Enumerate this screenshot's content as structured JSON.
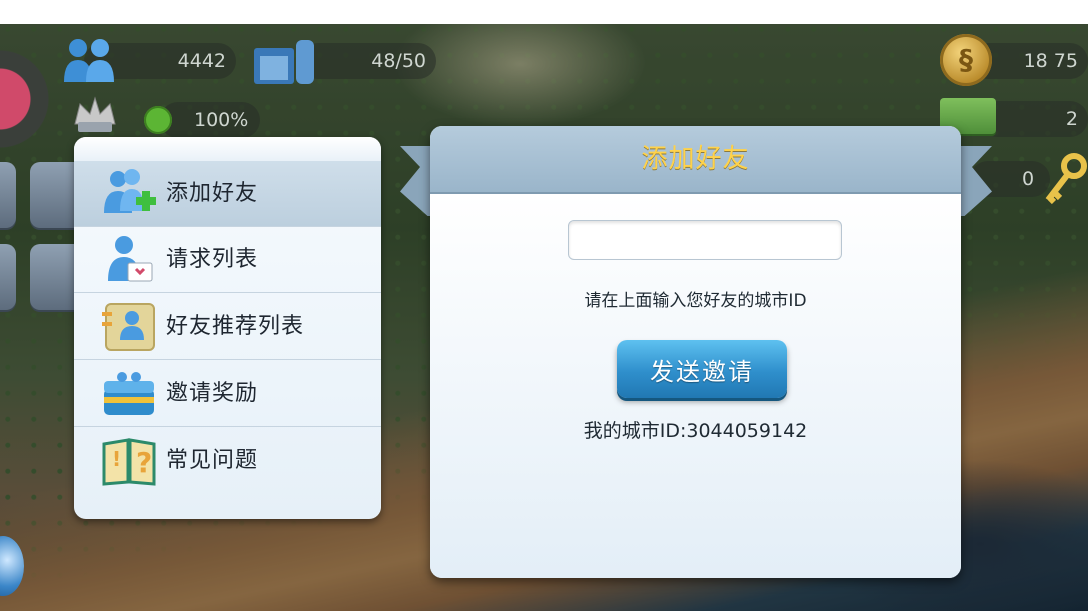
{
  "hud": {
    "population": "4442",
    "storage": "48/50",
    "happiness": "100%",
    "simoleons": "18 75",
    "simcash": "2",
    "keys": "0"
  },
  "menu": {
    "items": [
      {
        "label": "添加好友",
        "icon": "add-friend-icon"
      },
      {
        "label": "请求列表",
        "icon": "request-list-icon"
      },
      {
        "label": "好友推荐列表",
        "icon": "recommended-friends-icon"
      },
      {
        "label": "邀请奖励",
        "icon": "invite-reward-chest-icon"
      },
      {
        "label": "常见问题",
        "icon": "faq-book-icon"
      }
    ]
  },
  "dialog": {
    "title": "添加好友",
    "input_value": "",
    "hint": "请在上面输入您好友的城市ID",
    "send_label": "发送邀请",
    "my_city_id": "我的城市ID:3044059142"
  },
  "colors": {
    "title_yellow": "#ffd24a",
    "button_blue": "#2f8fcc",
    "panel_bg": "#e6f0f8"
  }
}
